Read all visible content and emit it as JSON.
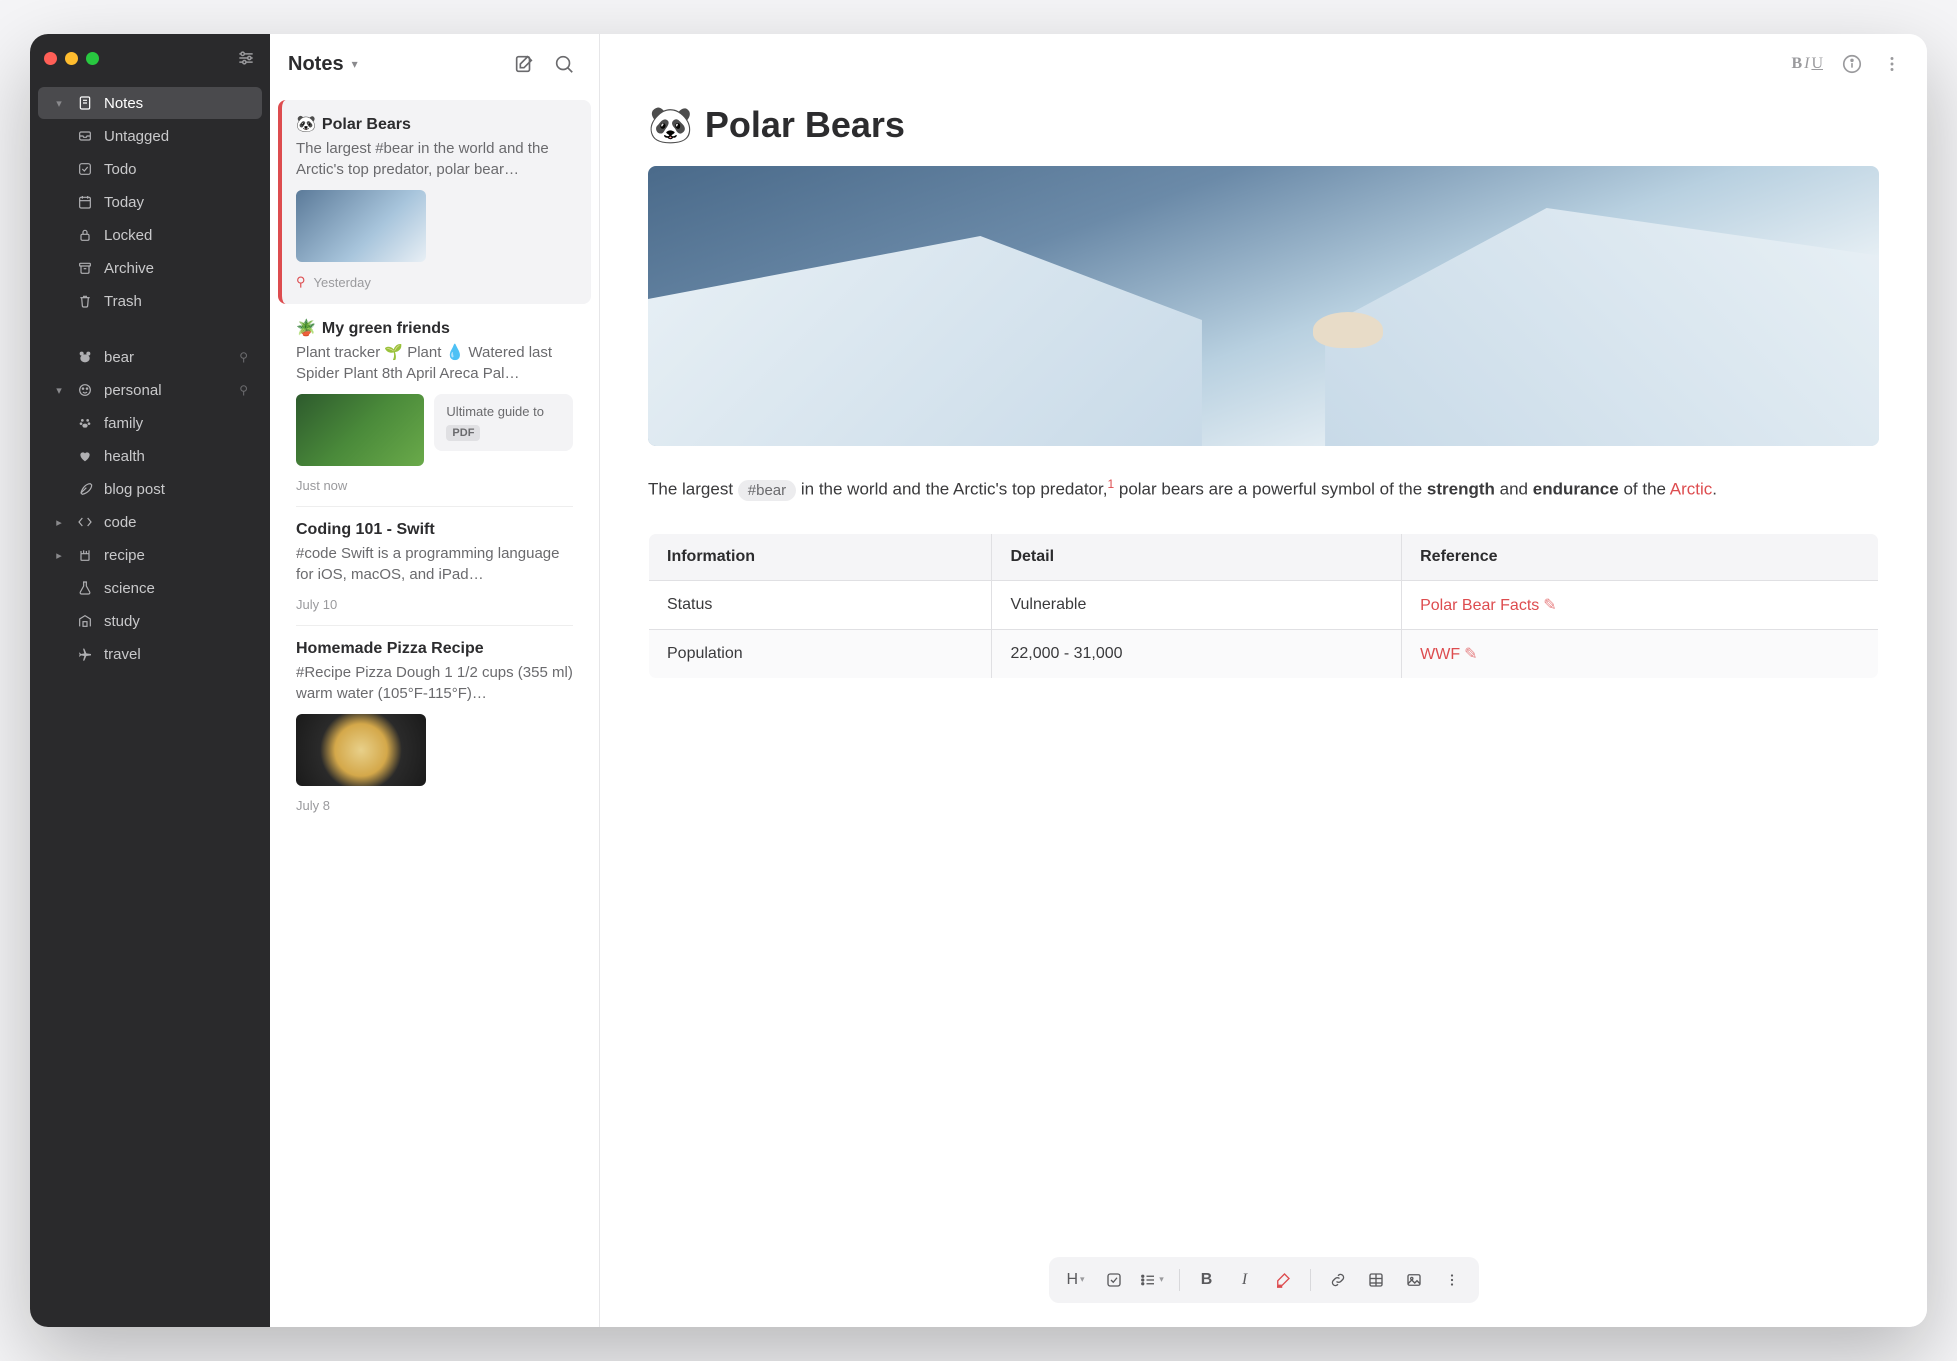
{
  "sidebar": {
    "groups": {
      "notes": {
        "label": "Notes"
      },
      "untagged": {
        "label": "Untagged"
      },
      "todo": {
        "label": "Todo"
      },
      "today": {
        "label": "Today"
      },
      "locked": {
        "label": "Locked"
      },
      "archive": {
        "label": "Archive"
      },
      "trash": {
        "label": "Trash"
      }
    },
    "tags": {
      "bear": {
        "label": "bear"
      },
      "personal": {
        "label": "personal"
      },
      "family": {
        "label": "family"
      },
      "health": {
        "label": "health"
      },
      "blogpost": {
        "label": "blog post"
      },
      "code": {
        "label": "code"
      },
      "recipe": {
        "label": "recipe"
      },
      "science": {
        "label": "science"
      },
      "study": {
        "label": "study"
      },
      "travel": {
        "label": "travel"
      }
    }
  },
  "notelist": {
    "title": "Notes",
    "items": [
      {
        "emoji": "🐼",
        "title": "Polar Bears",
        "excerpt": "The largest #bear in the world and the Arctic's top predator, polar bear…",
        "date": "Yesterday",
        "pinned": true
      },
      {
        "emoji": "🪴",
        "title": "My green friends",
        "excerpt": "Plant tracker 🌱 Plant 💧 Watered last Spider Plant 8th April Areca Pal…",
        "attachment": {
          "title": "Ultimate guide to",
          "badge": "PDF"
        },
        "date": "Just now"
      },
      {
        "title": "Coding 101 - Swift",
        "excerpt": "#code Swift is a programming language for iOS, macOS, and iPad…",
        "date": "July 10"
      },
      {
        "title": "Homemade Pizza Recipe",
        "excerpt": "#Recipe Pizza Dough 1 1/2 cups (355 ml) warm water (105°F-115°F)…",
        "date": "July 8"
      }
    ]
  },
  "editor": {
    "emoji": "🐼",
    "title": "Polar Bears",
    "body": {
      "lead1": "The largest ",
      "hashtag": "#bear",
      "lead2": " in the world and the Arctic's top predator,",
      "sup": "1",
      "lead3": " polar bears are a powerful symbol of the ",
      "strong1": "strength",
      "lead4": " and ",
      "strong2": "endurance",
      "lead5": " of the ",
      "link1": "Arctic",
      "lead6": "."
    },
    "table": {
      "headers": [
        "Information",
        "Detail",
        "Reference"
      ],
      "rows": [
        {
          "c0": "Status",
          "c1": "Vulnerable",
          "c2": "Polar Bear Facts"
        },
        {
          "c0": "Population",
          "c1": "22,000 - 31,000",
          "c2": "WWF"
        }
      ]
    },
    "toolbar": {
      "heading": "H",
      "bold": "B",
      "italic": "I"
    },
    "topbar": {
      "b": "B",
      "i": "I",
      "u": "U"
    }
  }
}
